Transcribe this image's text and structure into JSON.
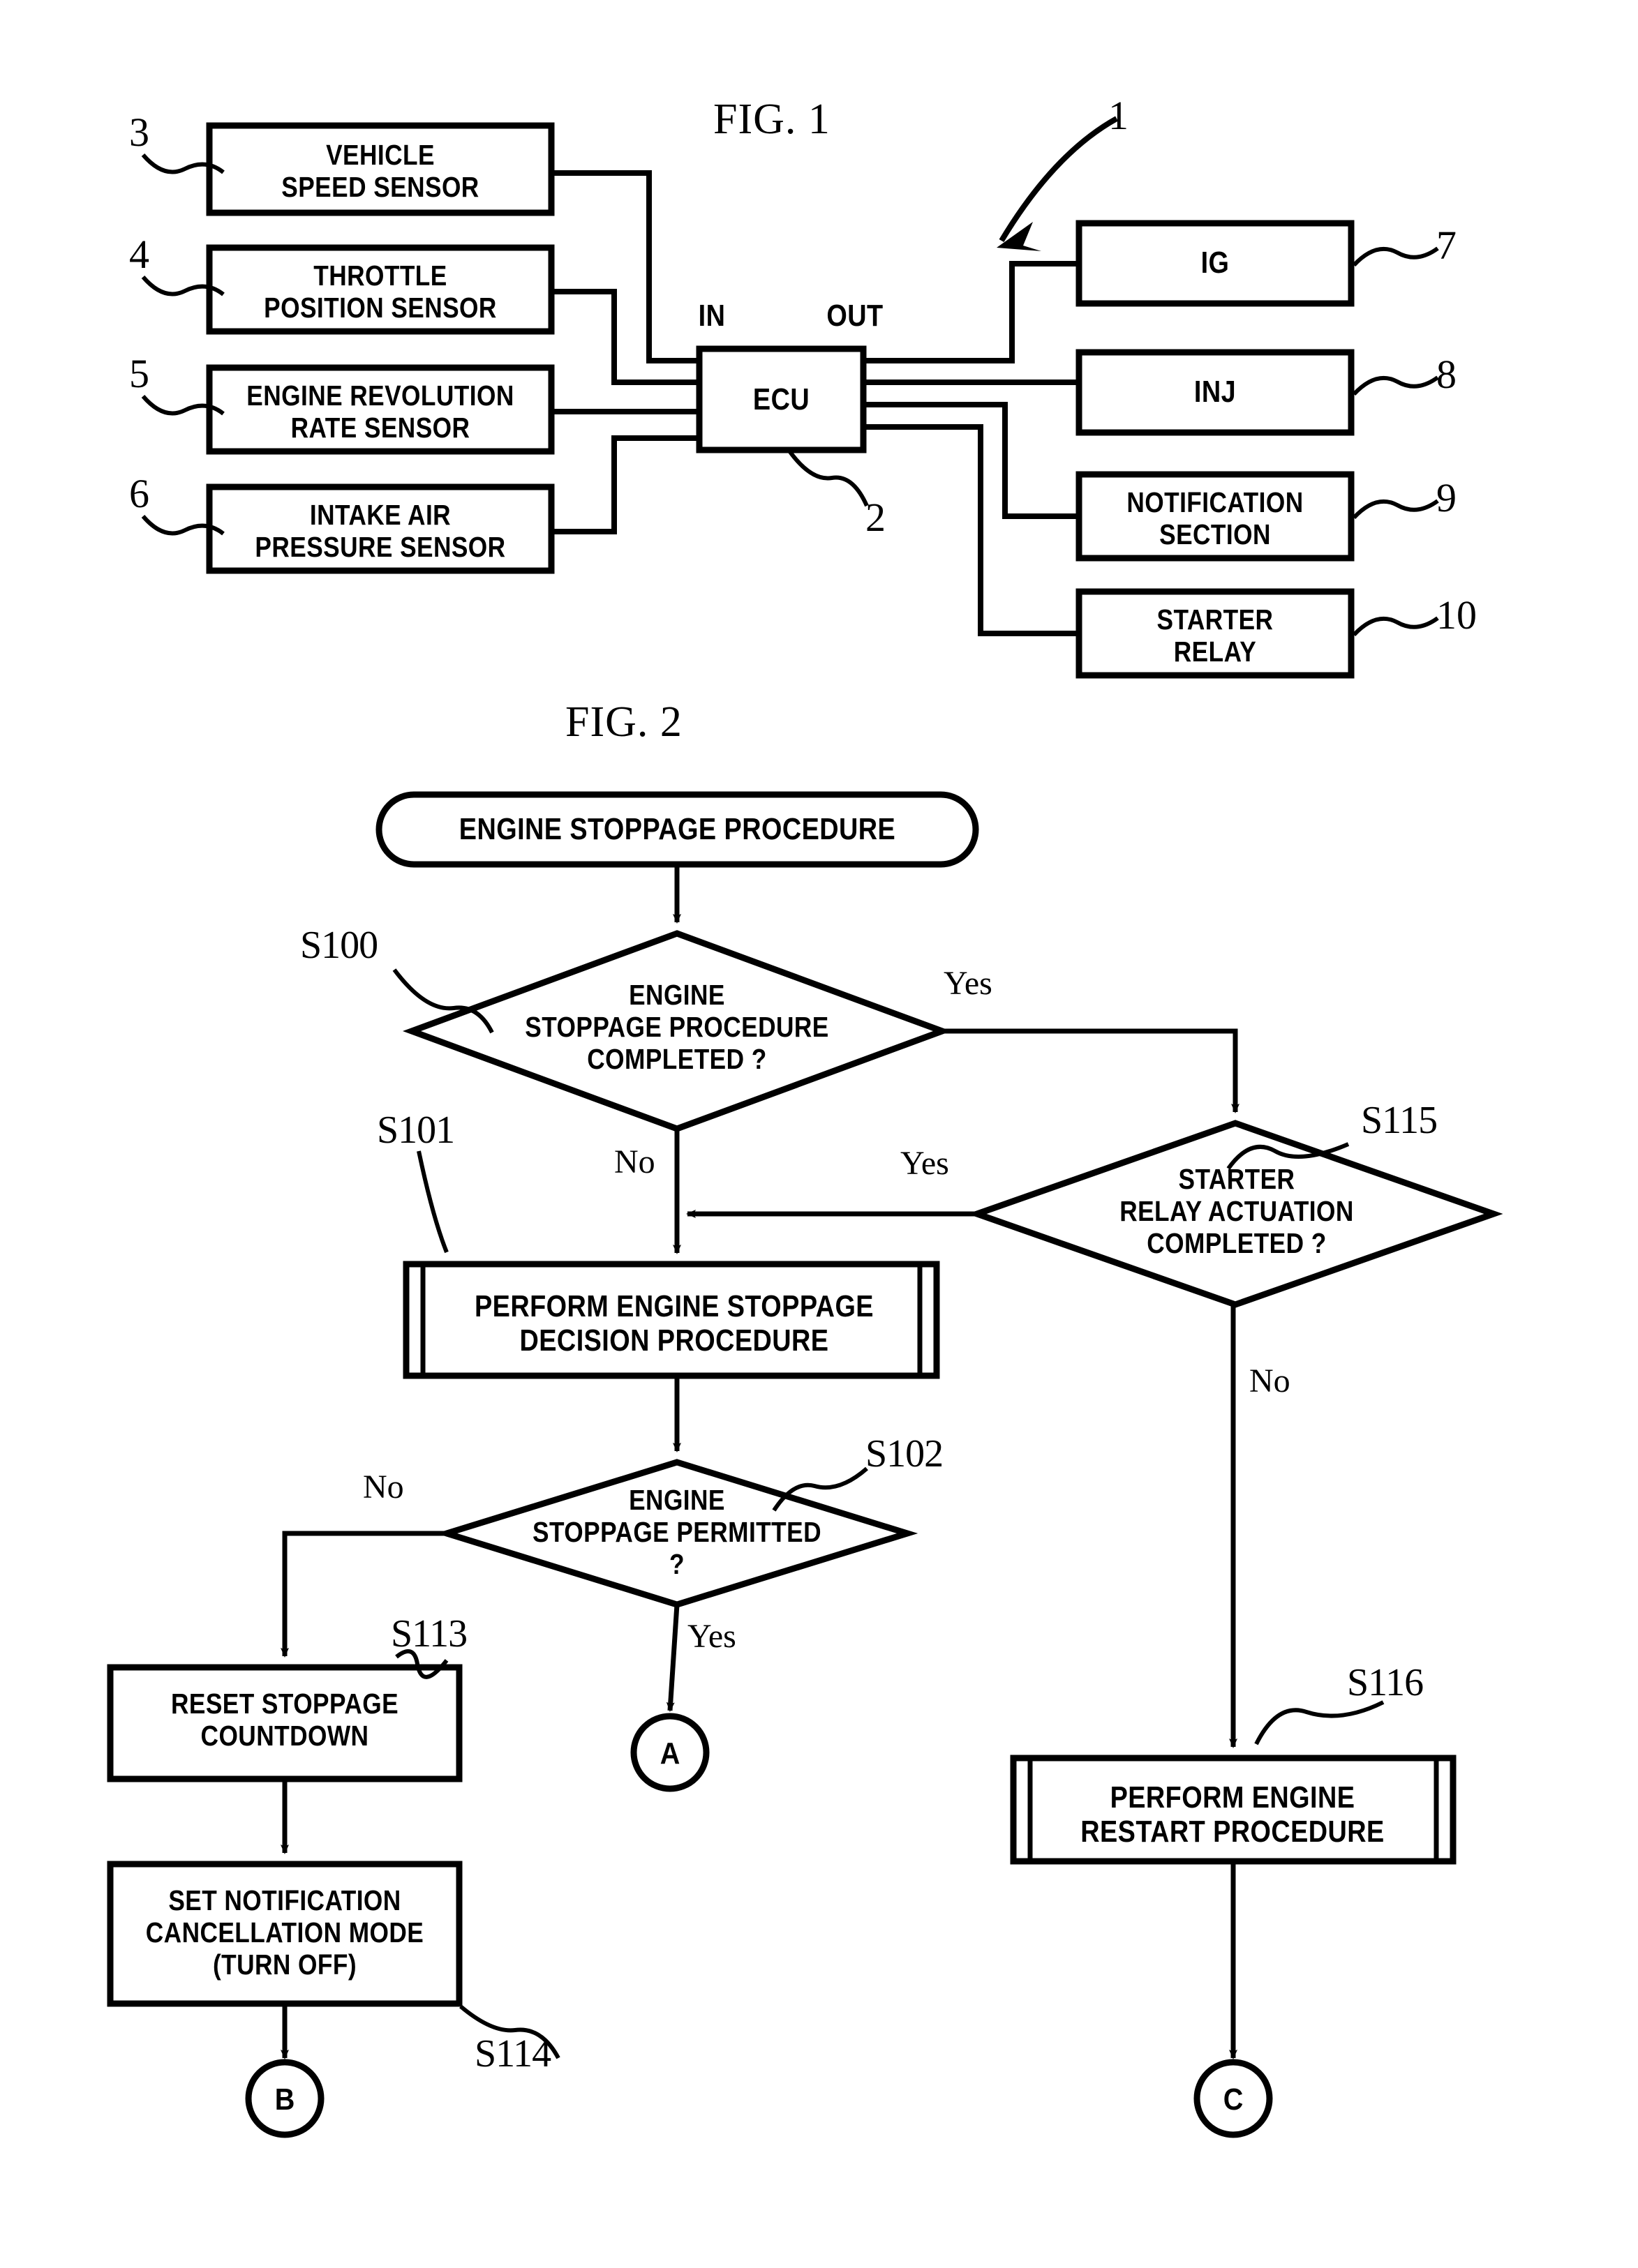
{
  "figures": [
    {
      "title": "FIG. 1",
      "callout": "1",
      "inputs": [
        {
          "ref": "3",
          "label": "VEHICLE\nSPEED SENSOR"
        },
        {
          "ref": "4",
          "label": "THROTTLE\nPOSITION SENSOR"
        },
        {
          "ref": "5",
          "label": "ENGINE REVOLUTION\nRATE SENSOR"
        },
        {
          "ref": "6",
          "label": "INTAKE AIR\nPRESSURE SENSOR"
        }
      ],
      "controller": {
        "ref": "2",
        "label": "ECU",
        "in_label": "IN",
        "out_label": "OUT"
      },
      "outputs": [
        {
          "ref": "7",
          "label": "IG"
        },
        {
          "ref": "8",
          "label": "INJ"
        },
        {
          "ref": "9",
          "label": "NOTIFICATION\nSECTION"
        },
        {
          "ref": "10",
          "label": "STARTER\nRELAY"
        }
      ]
    },
    {
      "title": "FIG. 2",
      "start": {
        "label": "ENGINE STOPPAGE PROCEDURE"
      },
      "nodes": [
        {
          "id": "S100",
          "type": "decision",
          "label": "ENGINE\nSTOPPAGE PROCEDURE\nCOMPLETED ?",
          "yes": "Yes",
          "no": "No"
        },
        {
          "id": "S115",
          "type": "decision",
          "label": "STARTER\nRELAY ACTUATION\nCOMPLETED ?",
          "yes": "Yes",
          "no": "No"
        },
        {
          "id": "S101",
          "type": "predefined",
          "label": "PERFORM ENGINE STOPPAGE\nDECISION PROCEDURE"
        },
        {
          "id": "S102",
          "type": "decision",
          "label": "ENGINE\nSTOPPAGE PERMITTED\n?",
          "yes": "Yes",
          "no": "No"
        },
        {
          "id": "S113",
          "type": "process",
          "label": "RESET STOPPAGE\nCOUNTDOWN"
        },
        {
          "id": "S114",
          "type": "process",
          "label": "SET NOTIFICATION\nCANCELLATION MODE\n(TURN OFF)"
        },
        {
          "id": "S116",
          "type": "predefined",
          "label": "PERFORM ENGINE\nRESTART PROCEDURE"
        }
      ],
      "connectors": [
        {
          "id": "A",
          "label": "A"
        },
        {
          "id": "B",
          "label": "B"
        },
        {
          "id": "C",
          "label": "C"
        }
      ]
    }
  ],
  "colors": {
    "ink": "#000000",
    "paper": "#ffffff"
  }
}
